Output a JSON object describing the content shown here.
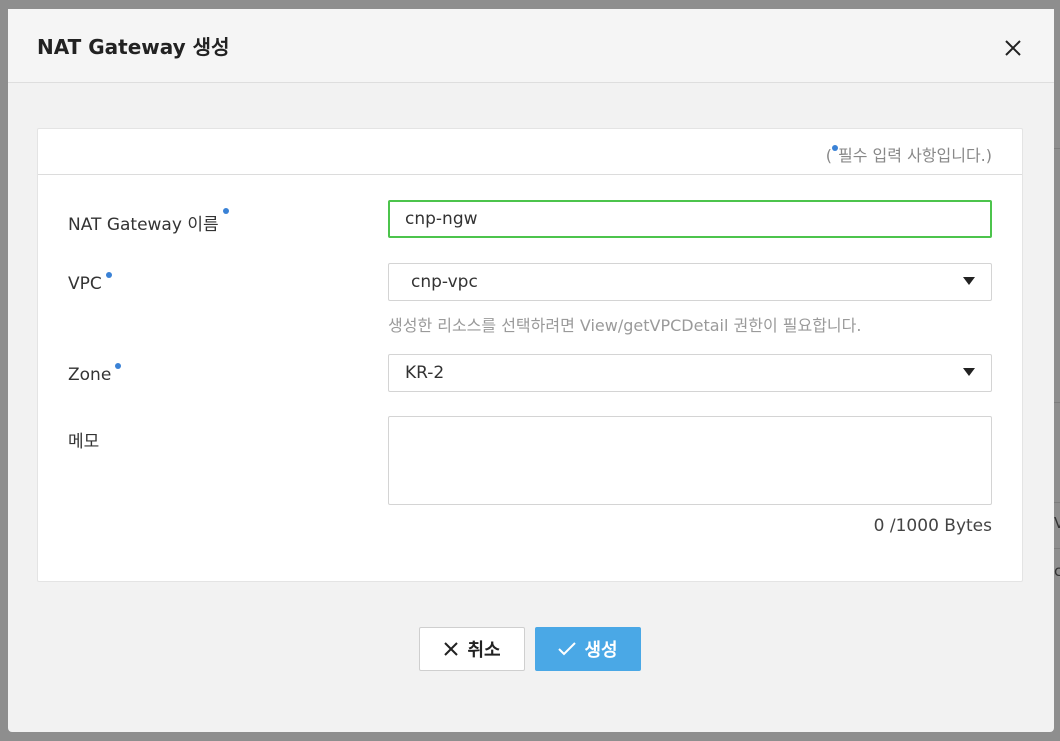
{
  "modal": {
    "title": "NAT Gateway 생성",
    "required_note_prefix": "(",
    "required_note_text": "필수 입력 사항입니다.)"
  },
  "form": {
    "name_label": "NAT Gateway 이름",
    "name_value": "cnp-ngw",
    "vpc_label": "VPC",
    "vpc_value": "cnp-vpc",
    "vpc_helper": "생성한 리소스를 선택하려면 View/getVPCDetail 권한이 필요합니다.",
    "zone_label": "Zone",
    "zone_value": "KR-2",
    "memo_label": "메모",
    "memo_value": "",
    "memo_counter": "0 /1000 Bytes"
  },
  "buttons": {
    "cancel_label": "취소",
    "create_label": "생성"
  },
  "background_fragments": {
    "text1": "V",
    "text2": "c"
  },
  "colors": {
    "required_dot": "#3a82d6",
    "input_focus_border": "#4cc44c",
    "create_button": "#4aa8e6"
  }
}
